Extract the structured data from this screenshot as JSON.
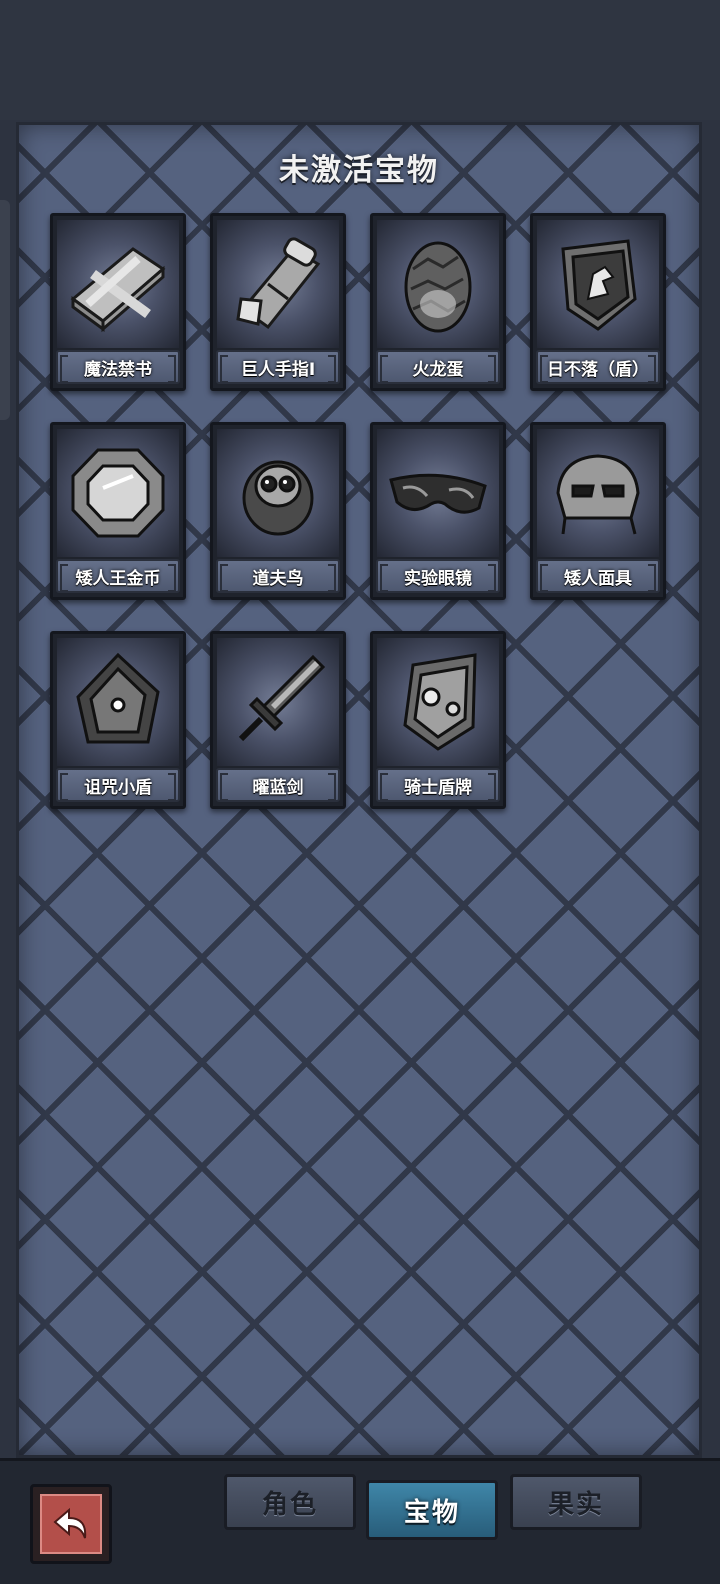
{
  "panel": {
    "title": "未激活宝物"
  },
  "items": [
    {
      "label": "魔法禁书",
      "icon": "spellbook-icon"
    },
    {
      "label": "巨人手指I",
      "icon": "giant-finger-icon"
    },
    {
      "label": "火龙蛋",
      "icon": "dragon-egg-icon"
    },
    {
      "label": "日不落（盾）",
      "icon": "lion-shield-icon"
    },
    {
      "label": "矮人王金币",
      "icon": "dwarf-coin-icon"
    },
    {
      "label": "道夫鸟",
      "icon": "owl-bird-icon"
    },
    {
      "label": "实验眼镜",
      "icon": "goggles-icon"
    },
    {
      "label": "矮人面具",
      "icon": "dwarf-mask-icon"
    },
    {
      "label": "诅咒小盾",
      "icon": "cursed-shield-icon"
    },
    {
      "label": "曜蓝剑",
      "icon": "sword-icon"
    },
    {
      "label": "骑士盾牌",
      "icon": "knight-shield-icon"
    }
  ],
  "tabs": [
    {
      "label": "角色",
      "active": false
    },
    {
      "label": "宝物",
      "active": true
    },
    {
      "label": "果实",
      "active": false
    }
  ],
  "back_button": {
    "icon": "back-arrow-icon"
  },
  "colors": {
    "panel": "#55627f",
    "active_tab": "#3f86a8",
    "back_button": "#b34f4a"
  }
}
